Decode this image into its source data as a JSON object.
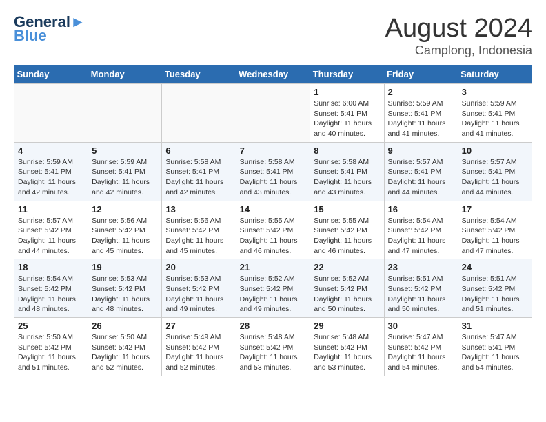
{
  "header": {
    "logo_line1": "General",
    "logo_line2": "Blue",
    "title": "August 2024",
    "subtitle": "Camplong, Indonesia"
  },
  "days_of_week": [
    "Sunday",
    "Monday",
    "Tuesday",
    "Wednesday",
    "Thursday",
    "Friday",
    "Saturday"
  ],
  "weeks": [
    [
      {
        "day": "",
        "info": ""
      },
      {
        "day": "",
        "info": ""
      },
      {
        "day": "",
        "info": ""
      },
      {
        "day": "",
        "info": ""
      },
      {
        "day": "1",
        "info": "Sunrise: 6:00 AM\nSunset: 5:41 PM\nDaylight: 11 hours\nand 40 minutes."
      },
      {
        "day": "2",
        "info": "Sunrise: 5:59 AM\nSunset: 5:41 PM\nDaylight: 11 hours\nand 41 minutes."
      },
      {
        "day": "3",
        "info": "Sunrise: 5:59 AM\nSunset: 5:41 PM\nDaylight: 11 hours\nand 41 minutes."
      }
    ],
    [
      {
        "day": "4",
        "info": "Sunrise: 5:59 AM\nSunset: 5:41 PM\nDaylight: 11 hours\nand 42 minutes."
      },
      {
        "day": "5",
        "info": "Sunrise: 5:59 AM\nSunset: 5:41 PM\nDaylight: 11 hours\nand 42 minutes."
      },
      {
        "day": "6",
        "info": "Sunrise: 5:58 AM\nSunset: 5:41 PM\nDaylight: 11 hours\nand 42 minutes."
      },
      {
        "day": "7",
        "info": "Sunrise: 5:58 AM\nSunset: 5:41 PM\nDaylight: 11 hours\nand 43 minutes."
      },
      {
        "day": "8",
        "info": "Sunrise: 5:58 AM\nSunset: 5:41 PM\nDaylight: 11 hours\nand 43 minutes."
      },
      {
        "day": "9",
        "info": "Sunrise: 5:57 AM\nSunset: 5:41 PM\nDaylight: 11 hours\nand 44 minutes."
      },
      {
        "day": "10",
        "info": "Sunrise: 5:57 AM\nSunset: 5:41 PM\nDaylight: 11 hours\nand 44 minutes."
      }
    ],
    [
      {
        "day": "11",
        "info": "Sunrise: 5:57 AM\nSunset: 5:42 PM\nDaylight: 11 hours\nand 44 minutes."
      },
      {
        "day": "12",
        "info": "Sunrise: 5:56 AM\nSunset: 5:42 PM\nDaylight: 11 hours\nand 45 minutes."
      },
      {
        "day": "13",
        "info": "Sunrise: 5:56 AM\nSunset: 5:42 PM\nDaylight: 11 hours\nand 45 minutes."
      },
      {
        "day": "14",
        "info": "Sunrise: 5:55 AM\nSunset: 5:42 PM\nDaylight: 11 hours\nand 46 minutes."
      },
      {
        "day": "15",
        "info": "Sunrise: 5:55 AM\nSunset: 5:42 PM\nDaylight: 11 hours\nand 46 minutes."
      },
      {
        "day": "16",
        "info": "Sunrise: 5:54 AM\nSunset: 5:42 PM\nDaylight: 11 hours\nand 47 minutes."
      },
      {
        "day": "17",
        "info": "Sunrise: 5:54 AM\nSunset: 5:42 PM\nDaylight: 11 hours\nand 47 minutes."
      }
    ],
    [
      {
        "day": "18",
        "info": "Sunrise: 5:54 AM\nSunset: 5:42 PM\nDaylight: 11 hours\nand 48 minutes."
      },
      {
        "day": "19",
        "info": "Sunrise: 5:53 AM\nSunset: 5:42 PM\nDaylight: 11 hours\nand 48 minutes."
      },
      {
        "day": "20",
        "info": "Sunrise: 5:53 AM\nSunset: 5:42 PM\nDaylight: 11 hours\nand 49 minutes."
      },
      {
        "day": "21",
        "info": "Sunrise: 5:52 AM\nSunset: 5:42 PM\nDaylight: 11 hours\nand 49 minutes."
      },
      {
        "day": "22",
        "info": "Sunrise: 5:52 AM\nSunset: 5:42 PM\nDaylight: 11 hours\nand 50 minutes."
      },
      {
        "day": "23",
        "info": "Sunrise: 5:51 AM\nSunset: 5:42 PM\nDaylight: 11 hours\nand 50 minutes."
      },
      {
        "day": "24",
        "info": "Sunrise: 5:51 AM\nSunset: 5:42 PM\nDaylight: 11 hours\nand 51 minutes."
      }
    ],
    [
      {
        "day": "25",
        "info": "Sunrise: 5:50 AM\nSunset: 5:42 PM\nDaylight: 11 hours\nand 51 minutes."
      },
      {
        "day": "26",
        "info": "Sunrise: 5:50 AM\nSunset: 5:42 PM\nDaylight: 11 hours\nand 52 minutes."
      },
      {
        "day": "27",
        "info": "Sunrise: 5:49 AM\nSunset: 5:42 PM\nDaylight: 11 hours\nand 52 minutes."
      },
      {
        "day": "28",
        "info": "Sunrise: 5:48 AM\nSunset: 5:42 PM\nDaylight: 11 hours\nand 53 minutes."
      },
      {
        "day": "29",
        "info": "Sunrise: 5:48 AM\nSunset: 5:42 PM\nDaylight: 11 hours\nand 53 minutes."
      },
      {
        "day": "30",
        "info": "Sunrise: 5:47 AM\nSunset: 5:42 PM\nDaylight: 11 hours\nand 54 minutes."
      },
      {
        "day": "31",
        "info": "Sunrise: 5:47 AM\nSunset: 5:41 PM\nDaylight: 11 hours\nand 54 minutes."
      }
    ]
  ]
}
